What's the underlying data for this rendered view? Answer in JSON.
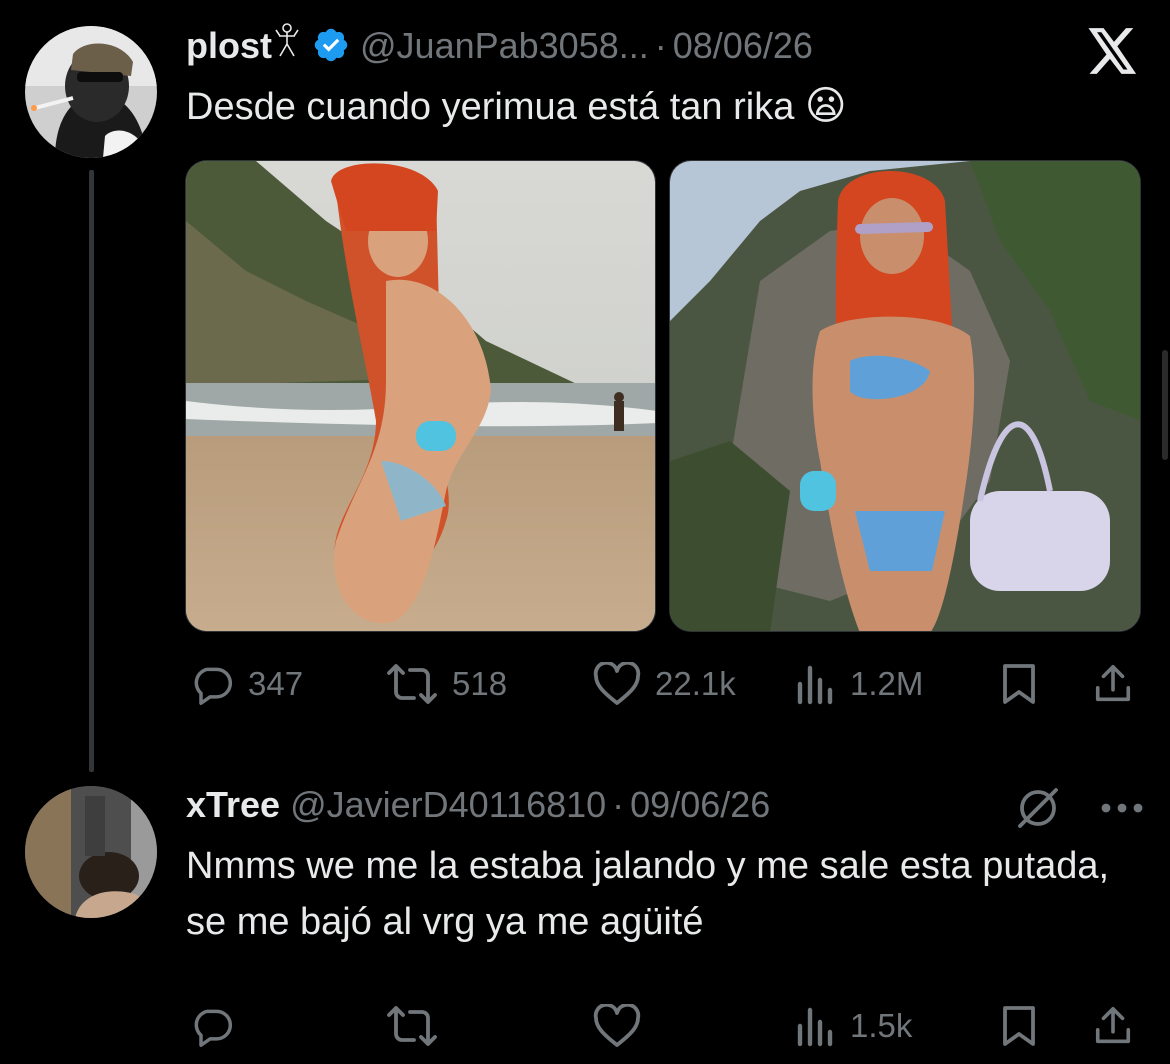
{
  "tweet1": {
    "display_name": "plost",
    "handle": "@JuanPab3058...",
    "separator": "·",
    "date": "08/06/26",
    "text": "Desde cuando yerimua está tan rika",
    "emoji": "😦",
    "stats": {
      "replies": "347",
      "retweets": "518",
      "likes": "22.1k",
      "views": "1.2M"
    }
  },
  "tweet2": {
    "display_name": "xTree",
    "handle": "@JavierD40116810",
    "separator": "·",
    "date": "09/06/26",
    "text": "Nmms we me la estaba jalando y me sale esta putada, se me bajó al vrg ya me agüité",
    "stats": {
      "views": "1.5k"
    }
  },
  "colors": {
    "background": "#000000",
    "primary_text": "#e7e9ea",
    "secondary_text": "#71767b",
    "verified_blue": "#1d9bf0",
    "thread_line": "#333639"
  },
  "icons": [
    "x-logo-icon",
    "verified-badge-icon",
    "reply-icon",
    "retweet-icon",
    "like-icon",
    "views-icon",
    "bookmark-icon",
    "share-icon",
    "more-icon",
    "grok-icon"
  ]
}
